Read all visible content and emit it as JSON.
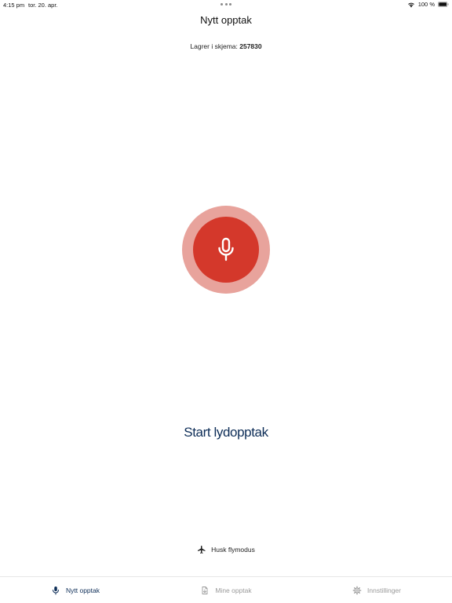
{
  "status_bar": {
    "time": "4:15 pm",
    "date": "tor. 20. apr.",
    "battery": "100 %"
  },
  "header": {
    "title": "Nytt opptak"
  },
  "save_info": {
    "label": "Lagrer i skjema:",
    "value": "257830"
  },
  "record": {
    "label": "Start lydopptak",
    "icon": "microphone-icon",
    "accent_color": "#d4382b",
    "halo_color": "#e8a39c"
  },
  "reminder": {
    "icon": "airplane-icon",
    "text": "Husk flymodus"
  },
  "tabs": [
    {
      "label": "Nytt opptak",
      "icon": "microphone-icon",
      "active": true
    },
    {
      "label": "Mine opptak",
      "icon": "document-download-icon",
      "active": false
    },
    {
      "label": "Innstillinger",
      "icon": "gear-icon",
      "active": false
    }
  ]
}
